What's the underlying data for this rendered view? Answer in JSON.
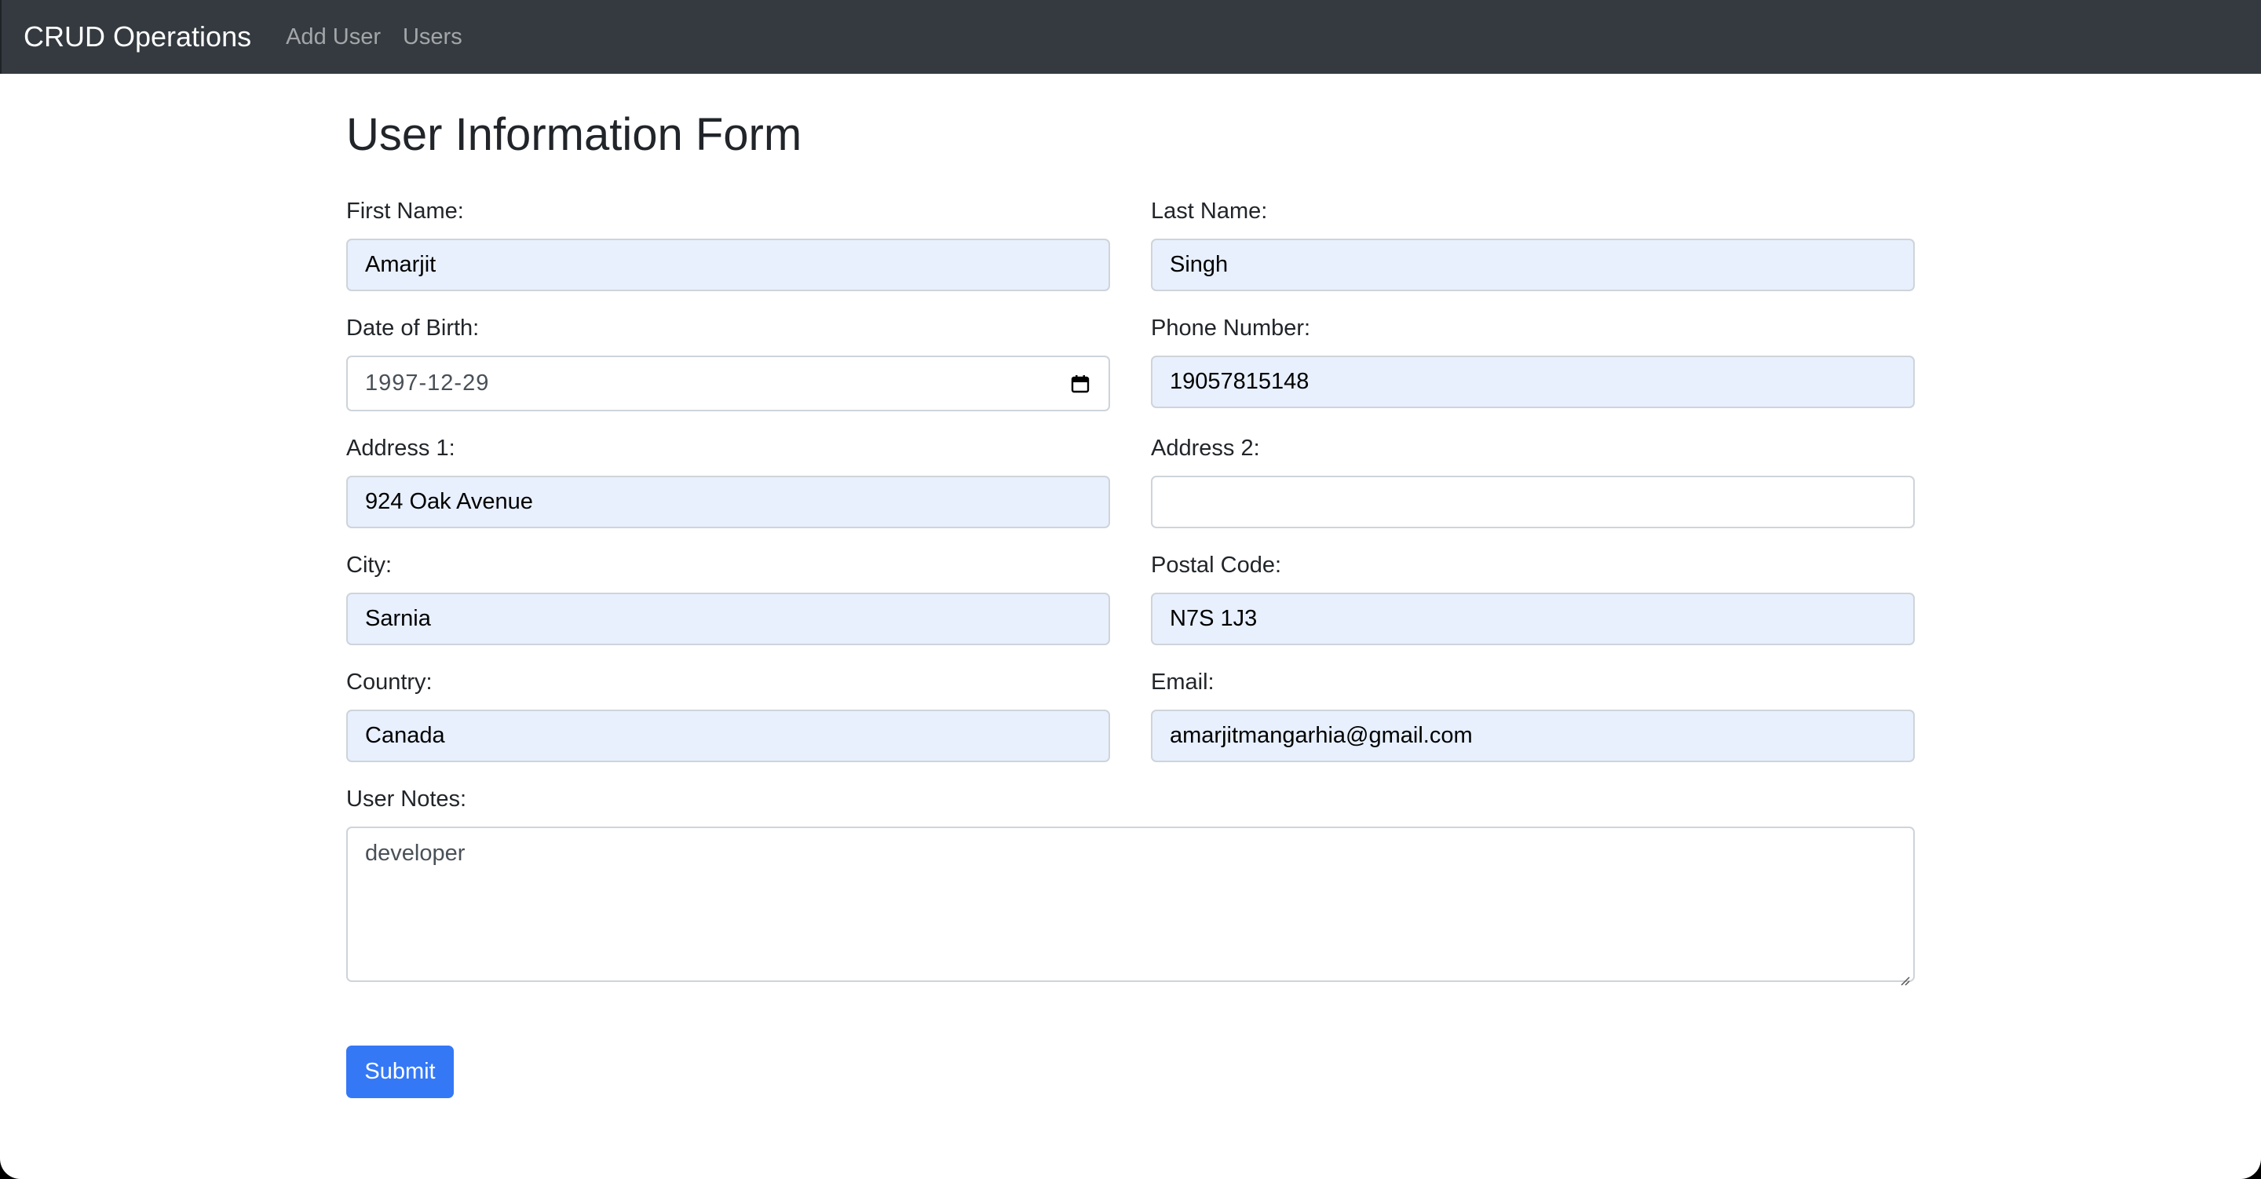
{
  "navbar": {
    "brand": "CRUD Operations",
    "links": [
      "Add User",
      "Users"
    ]
  },
  "page": {
    "title": "User Information Form"
  },
  "form": {
    "first_name": {
      "label": "First Name:",
      "value": "Amarjit"
    },
    "last_name": {
      "label": "Last Name:",
      "value": "Singh"
    },
    "dob": {
      "label": "Date of Birth:",
      "value": "1997-12-29"
    },
    "phone": {
      "label": "Phone Number:",
      "value": "19057815148"
    },
    "address1": {
      "label": "Address 1:",
      "value": "924 Oak Avenue"
    },
    "address2": {
      "label": "Address 2:",
      "value": ""
    },
    "city": {
      "label": "City:",
      "value": "Sarnia"
    },
    "postal_code": {
      "label": "Postal Code:",
      "value": "N7S 1J3"
    },
    "country": {
      "label": "Country:",
      "value": "Canada"
    },
    "email": {
      "label": "Email:",
      "value": "amarjitmangarhia@gmail.com"
    },
    "notes": {
      "label": "User Notes:",
      "value": "developer"
    },
    "submit_label": "Submit"
  },
  "colors": {
    "navbar_bg": "#343a40",
    "autofill_bg": "#e8f0fe",
    "primary_button": "#3478f6"
  },
  "icons": {
    "date_picker": "calendar-icon",
    "textarea_resize": "resize-handle-icon"
  }
}
